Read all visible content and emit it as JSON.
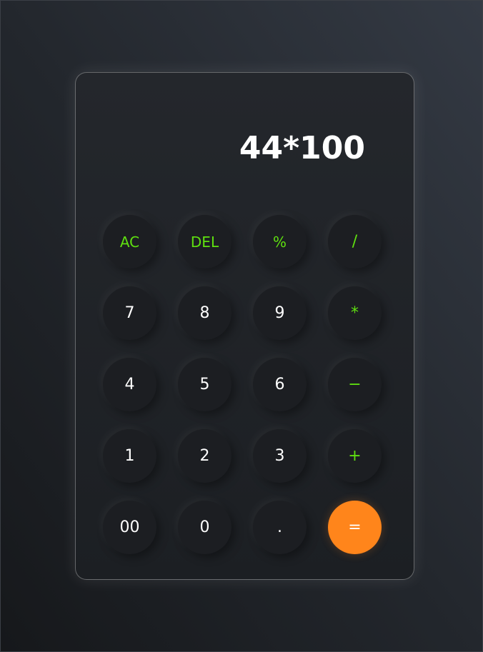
{
  "display": {
    "value": "44*100"
  },
  "keys": [
    {
      "name": "clear-all-button",
      "label": "AC",
      "kind": "fn"
    },
    {
      "name": "delete-button",
      "label": "DEL",
      "kind": "fn"
    },
    {
      "name": "percent-button",
      "label": "%",
      "kind": "fn"
    },
    {
      "name": "divide-button",
      "label": "/",
      "kind": "op"
    },
    {
      "name": "digit-7-button",
      "label": "7",
      "kind": "num"
    },
    {
      "name": "digit-8-button",
      "label": "8",
      "kind": "num"
    },
    {
      "name": "digit-9-button",
      "label": "9",
      "kind": "num"
    },
    {
      "name": "multiply-button",
      "label": "*",
      "kind": "op"
    },
    {
      "name": "digit-4-button",
      "label": "4",
      "kind": "num"
    },
    {
      "name": "digit-5-button",
      "label": "5",
      "kind": "num"
    },
    {
      "name": "digit-6-button",
      "label": "6",
      "kind": "num"
    },
    {
      "name": "subtract-button",
      "label": "−",
      "kind": "op"
    },
    {
      "name": "digit-1-button",
      "label": "1",
      "kind": "num"
    },
    {
      "name": "digit-2-button",
      "label": "2",
      "kind": "num"
    },
    {
      "name": "digit-3-button",
      "label": "3",
      "kind": "num"
    },
    {
      "name": "add-button",
      "label": "+",
      "kind": "op"
    },
    {
      "name": "double-zero-button",
      "label": "00",
      "kind": "num"
    },
    {
      "name": "digit-0-button",
      "label": "0",
      "kind": "num"
    },
    {
      "name": "decimal-point-button",
      "label": ".",
      "kind": "num"
    },
    {
      "name": "equals-button",
      "label": "=",
      "kind": "eq"
    }
  ],
  "colors": {
    "operator": "#5fe010",
    "equals": "#ff851b",
    "digit": "#ffffff"
  }
}
